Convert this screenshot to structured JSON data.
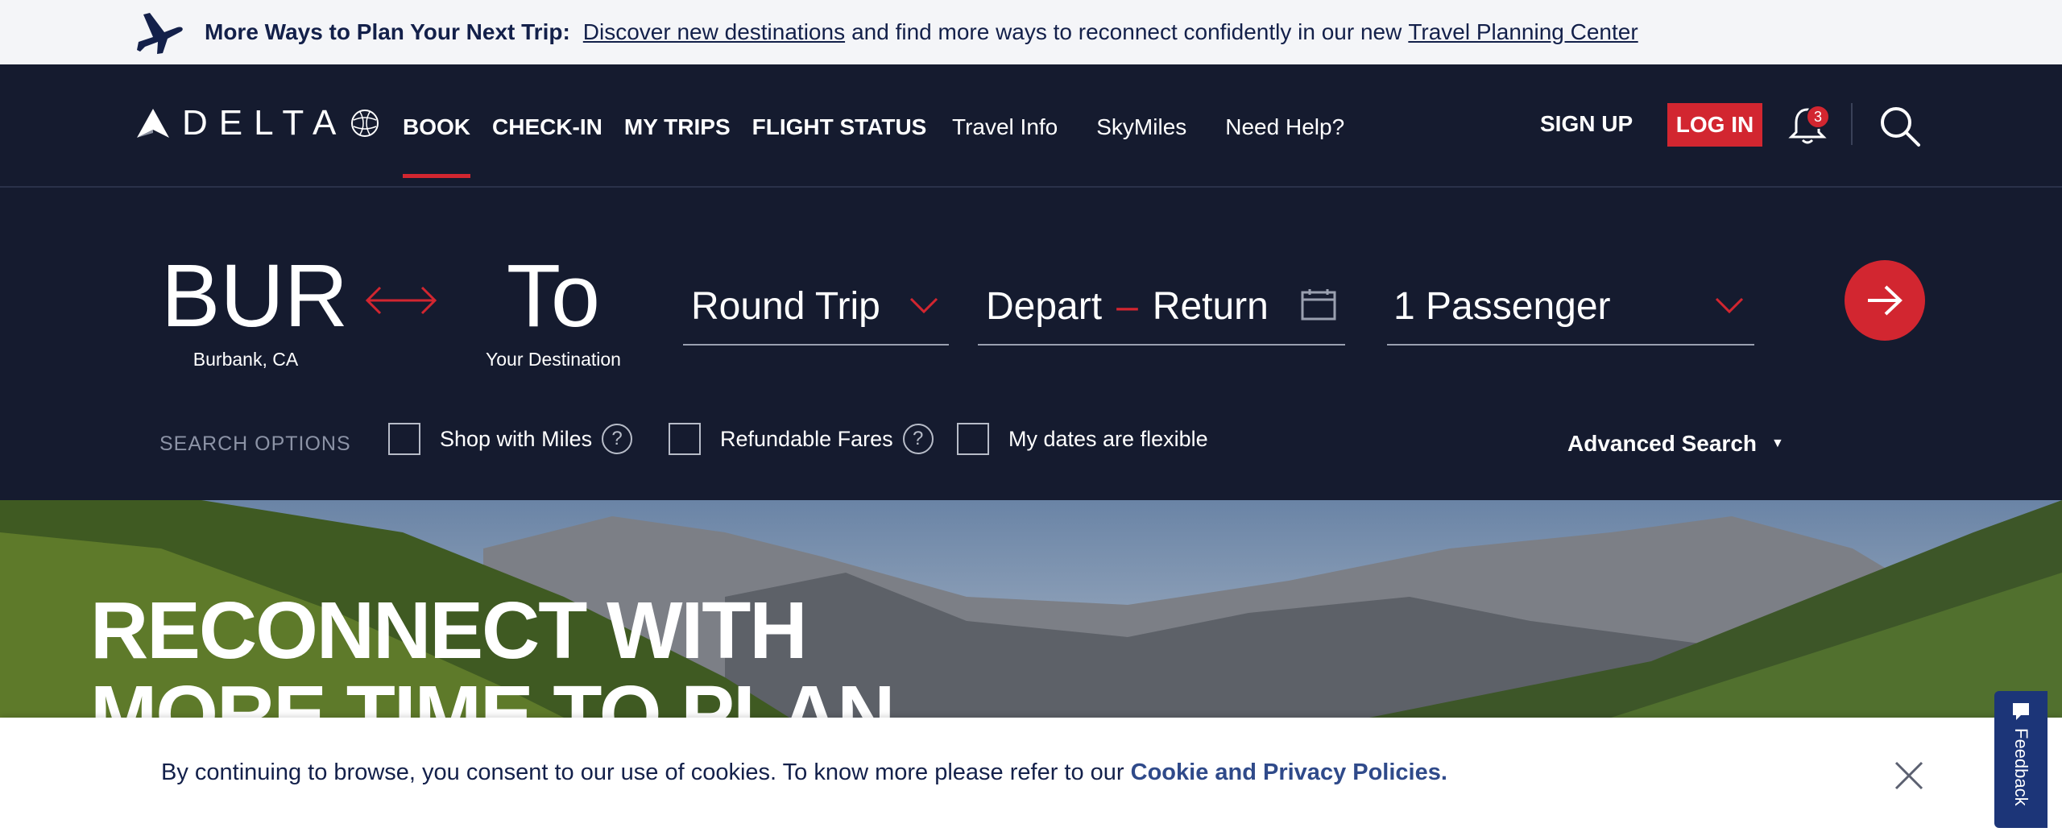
{
  "promo": {
    "bold": "More Ways to Plan Your Next Trip:",
    "link1": "Discover new destinations",
    "middle": "and find more ways to reconnect confidently in our new",
    "link2": "Travel Planning Center"
  },
  "header": {
    "logo_text": "DELTA",
    "nav_main": [
      "BOOK",
      "CHECK-IN",
      "MY TRIPS",
      "FLIGHT STATUS"
    ],
    "nav_secondary": [
      "Travel Info",
      "SkyMiles",
      "Need Help?"
    ],
    "signup": "SIGN UP",
    "login": "LOG IN",
    "notification_count": "3",
    "icons": [
      "bell-icon",
      "search-icon"
    ]
  },
  "booking": {
    "from_code": "BUR",
    "from_city": "Burbank, CA",
    "to_code": "To",
    "to_city": "Your Destination",
    "trip_type": "Round Trip",
    "depart": "Depart",
    "return": "Return",
    "passengers": "1 Passenger",
    "search_options_label": "SEARCH OPTIONS",
    "options": [
      "Shop with Miles",
      "Refundable Fares",
      "My dates are flexible"
    ],
    "advanced": "Advanced Search",
    "accent_color": "#d22630"
  },
  "hero": {
    "line1": "RECONNECT WITH",
    "line2": "MORE TIME TO PLAN"
  },
  "cookie": {
    "text": "By continuing to browse, you consent to our use of cookies. To know more please refer to our",
    "link": "Cookie and Privacy Policies."
  },
  "feedback": {
    "label": "Feedback"
  }
}
